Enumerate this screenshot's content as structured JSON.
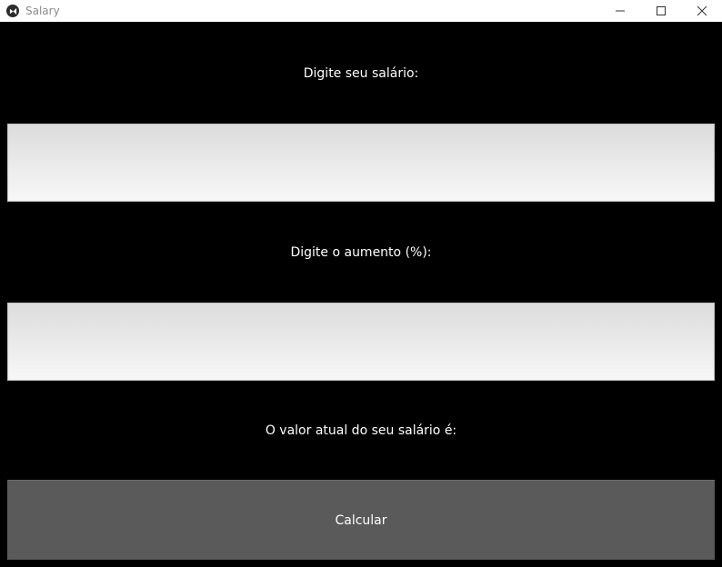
{
  "window": {
    "title": "Salary",
    "icon": "kivy-app-icon",
    "controls": [
      "minimize-icon",
      "maximize-icon",
      "close-icon"
    ]
  },
  "form": {
    "salary_label": "Digite seu salário:",
    "salary_value": "",
    "raise_label": "Digite o aumento (%):",
    "raise_value": "",
    "result_label": "O valor atual do seu salário é:",
    "calculate_label": "Calcular"
  },
  "colors": {
    "background": "#000000",
    "titlebar": "#ffffff",
    "button": "#5a5a5a",
    "text": "#ffffff"
  }
}
